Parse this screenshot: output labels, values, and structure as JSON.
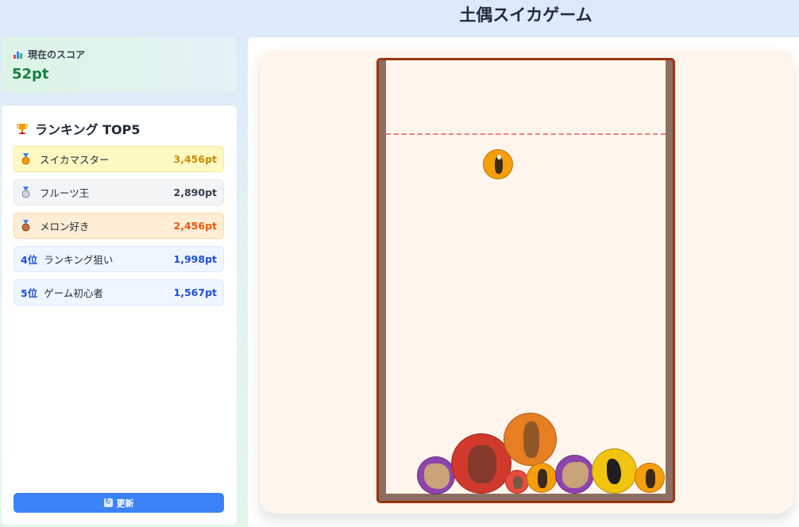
{
  "header": {
    "title": "土偶スイカゲーム"
  },
  "score": {
    "label": "現在のスコア",
    "value": "52pt",
    "icon": "chart-icon"
  },
  "ranking": {
    "title": "ランキング TOP5",
    "icon": "trophy-icon",
    "rows": [
      {
        "medal": "gold-medal-icon",
        "pos": "",
        "name": "スイカマスター",
        "points": "3,456pt"
      },
      {
        "medal": "silver-medal-icon",
        "pos": "",
        "name": "フルーツ王",
        "points": "2,890pt"
      },
      {
        "medal": "bronze-medal-icon",
        "pos": "",
        "name": "メロン好き",
        "points": "2,456pt"
      },
      {
        "medal": "",
        "pos": "4位",
        "name": "ランキング狙い",
        "points": "1,998pt"
      },
      {
        "medal": "",
        "pos": "5位",
        "name": "ゲーム初心者",
        "points": "1,567pt"
      }
    ],
    "refresh_label": "更新",
    "refresh_icon": "refresh-icon"
  },
  "game": {
    "colors": {
      "container_border": "#9a3412",
      "wall": "#8d6e63",
      "deadline": "#f08080",
      "background": "#fff5ec"
    },
    "pieces": {
      "orange_small": "#f59e0b",
      "purple": "#8e44ad",
      "red_large": "#d0392b",
      "red_small": "#e74c3c",
      "orange_large": "#e67e22",
      "yellow": "#f1c40f"
    }
  }
}
